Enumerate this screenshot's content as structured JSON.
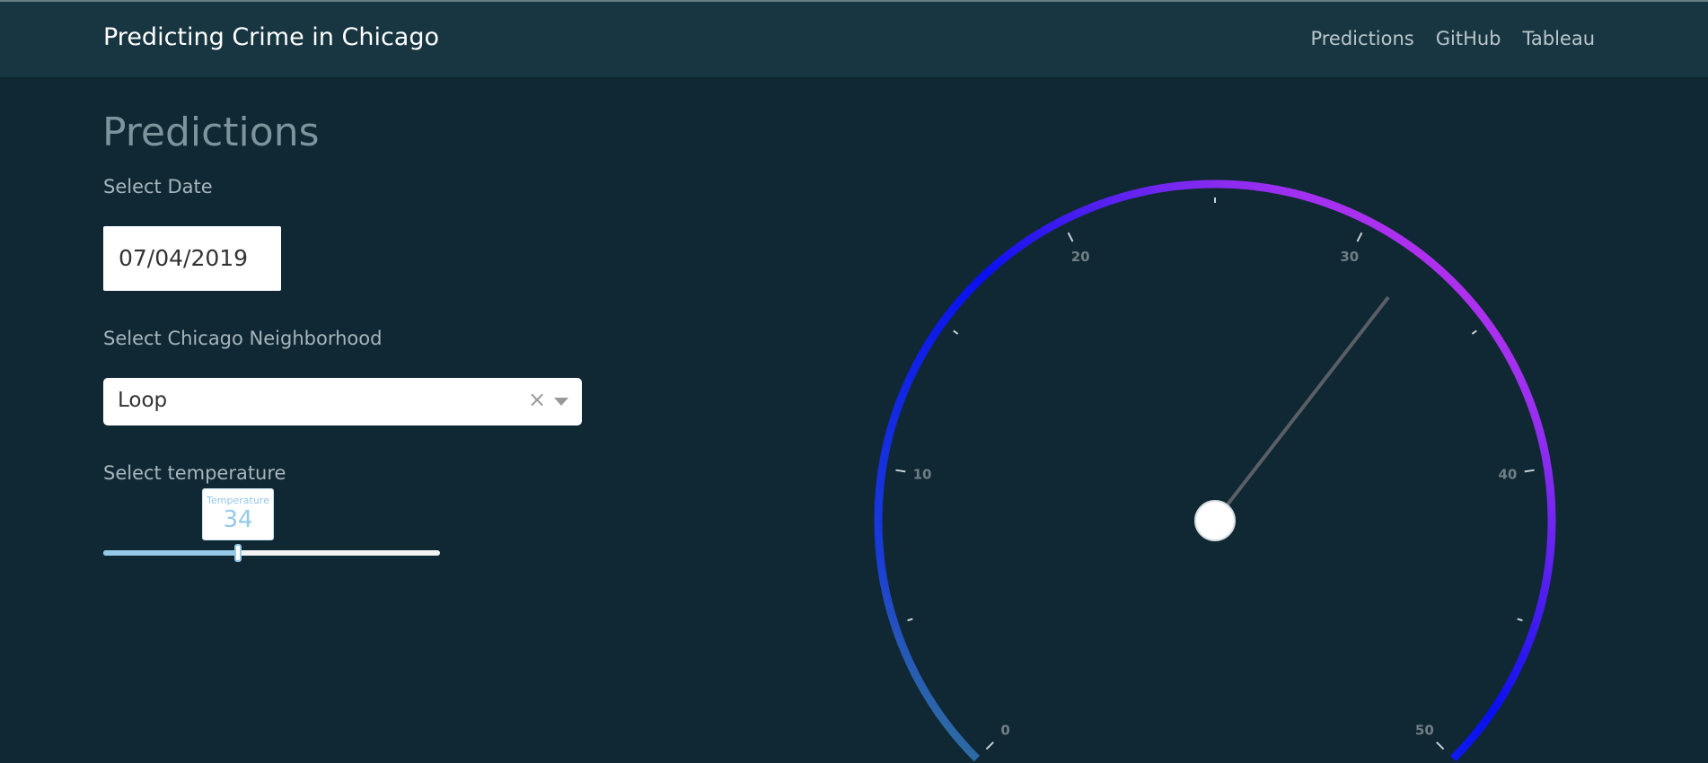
{
  "navbar": {
    "brand": "Predicting Crime in Chicago",
    "links": [
      "Predictions",
      "GitHub",
      "Tableau"
    ]
  },
  "page": {
    "title": "Predictions"
  },
  "date_picker": {
    "label": "Select Date",
    "value": "07/04/2019"
  },
  "neighborhood": {
    "label": "Select Chicago Neighborhood",
    "value": "Loop",
    "clear_glyph": "×"
  },
  "temperature": {
    "label": "Select temperature",
    "tooltip_label": "Temperature",
    "value": 34,
    "slider_fraction": 0.4
  },
  "gauge": {
    "min": 0,
    "max": 50,
    "value": 32,
    "tick_labels": [
      "0",
      "10",
      "20",
      "30",
      "40",
      "50"
    ],
    "colors": {
      "start": "#3a8a80",
      "low": "#1a3ad8",
      "mid": "#0a10f0",
      "high": "#a030f0",
      "end": "#e030e8",
      "needle": "#5a5f66",
      "hub": "#ffffff",
      "tick_label": "#707e85",
      "tick": "#c8d0d4"
    }
  },
  "icons": {
    "clear": "clear-icon",
    "dropdown": "chevron-down-icon"
  }
}
